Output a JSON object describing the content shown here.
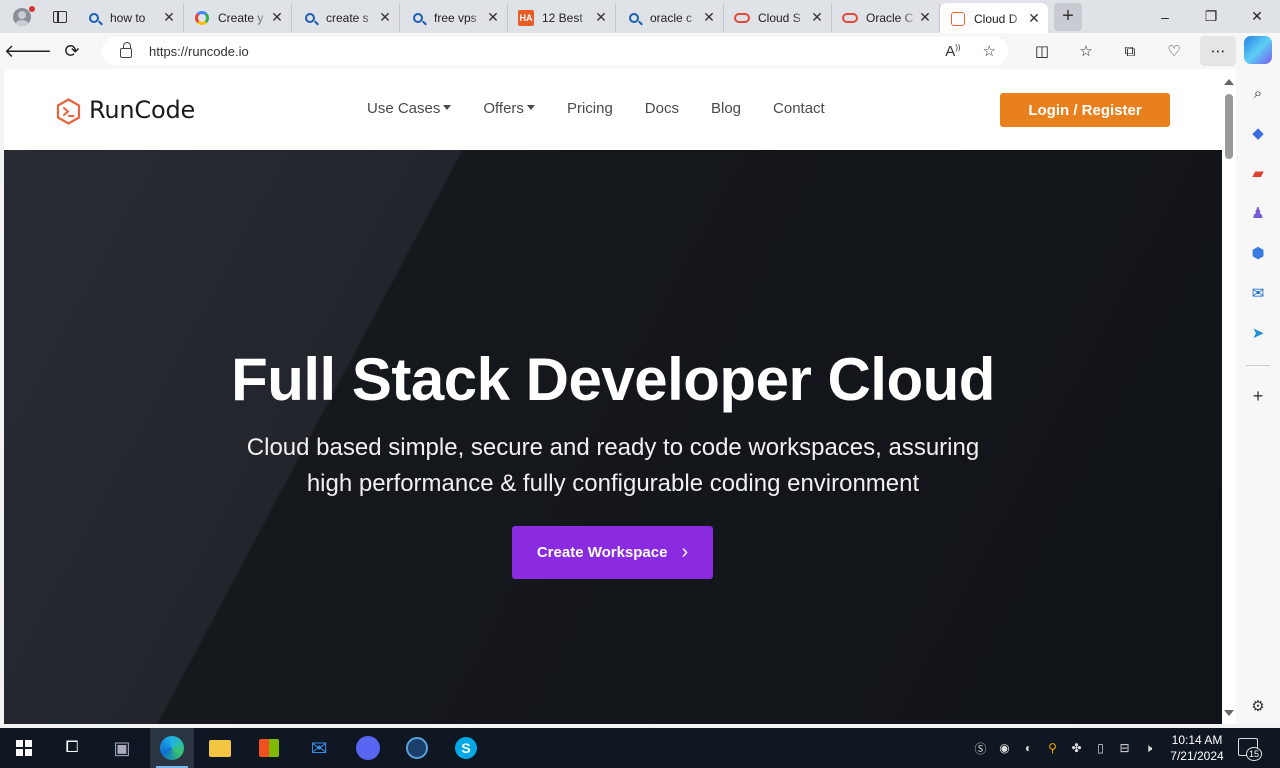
{
  "browser": {
    "tabs": [
      {
        "title": "how to",
        "favicon": "search-icon"
      },
      {
        "title": "Create y",
        "favicon": "google-icon"
      },
      {
        "title": "create s",
        "favicon": "search-icon"
      },
      {
        "title": "free vps",
        "favicon": "search-icon"
      },
      {
        "title": "12 Best",
        "favicon": "ha-icon"
      },
      {
        "title": "oracle c",
        "favicon": "search-icon"
      },
      {
        "title": "Cloud S",
        "favicon": "oracle-icon"
      },
      {
        "title": "Oracle C",
        "favicon": "oracle-icon"
      },
      {
        "title": "Cloud D",
        "favicon": "runcode-icon"
      }
    ],
    "active_tab_index": 8,
    "address": "https://runcode.io",
    "window_controls": {
      "minimize": "–",
      "restore": "❐",
      "close": "✕"
    },
    "new_tab": "+"
  },
  "site": {
    "brand": "RunCode",
    "nav": {
      "use_cases": "Use Cases",
      "offers": "Offers",
      "pricing": "Pricing",
      "docs": "Docs",
      "blog": "Blog",
      "contact": "Contact"
    },
    "login_label": "Login / Register",
    "hero": {
      "title": "Full Stack Developer Cloud",
      "subtitle_line1": "Cloud based simple, secure and ready to code workspaces, assuring",
      "subtitle_line2": "high performance & fully configurable coding environment",
      "cta_label": "Create Workspace",
      "cta_arrow": "›"
    },
    "colors": {
      "accent_orange": "#e9801e",
      "cta_purple": "#8a2be2",
      "hero_dark": "#15181d"
    }
  },
  "taskbar": {
    "time": "10:14 AM",
    "date": "7/21/2024",
    "notification_count": "15"
  }
}
